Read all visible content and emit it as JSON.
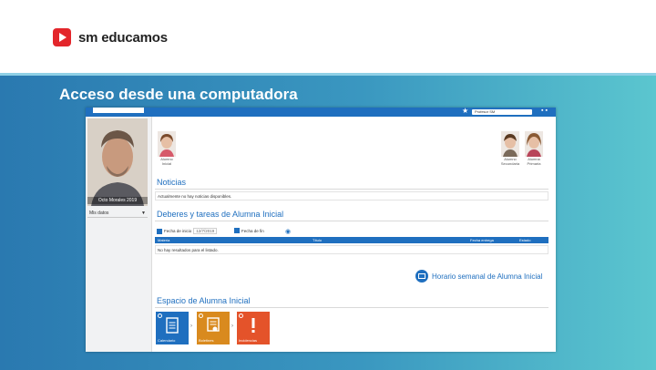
{
  "brand": {
    "name": "sm educamos",
    "color": "#e3262b"
  },
  "slide": {
    "title": "Acceso desde una computadora"
  },
  "app": {
    "header": {
      "user": "Profesor SM",
      "accent": "#1f6fbf"
    },
    "profile": {
      "name": "Octo Morales 2019"
    },
    "sidebar": {
      "my_data": "Mis datos"
    },
    "students": [
      {
        "label_1": "Alumno",
        "label_2": "Inicial"
      },
      {
        "label_1": "Alumno",
        "label_2": "Secundaria"
      },
      {
        "label_1": "Alumna",
        "label_2": "Primaria"
      }
    ],
    "news": {
      "title": "Noticias",
      "empty": "Actualmente no hay noticias disponibles."
    },
    "homework": {
      "title": "Deberes y tareas de Alumna Inicial",
      "start_label": "Fecha de inicio",
      "start_value": "12/7/2019",
      "end_label": "Fecha de fin",
      "columns": [
        "Materia",
        "Título",
        "Fecha entrega",
        "Estado"
      ],
      "empty": "No hay resultados para el listado."
    },
    "schedule_link": "Horario semanal de Alumna Inicial",
    "space": {
      "title": "Espacio de Alumna Inicial",
      "tiles": [
        {
          "label": "Calendario",
          "color": "#1f6fbf",
          "icon": "document-icon"
        },
        {
          "label": "Boletines",
          "color": "#d98a1e",
          "icon": "certificate-icon"
        },
        {
          "label": "Incidencias",
          "color": "#e4532a",
          "icon": "alert-icon"
        }
      ]
    }
  }
}
